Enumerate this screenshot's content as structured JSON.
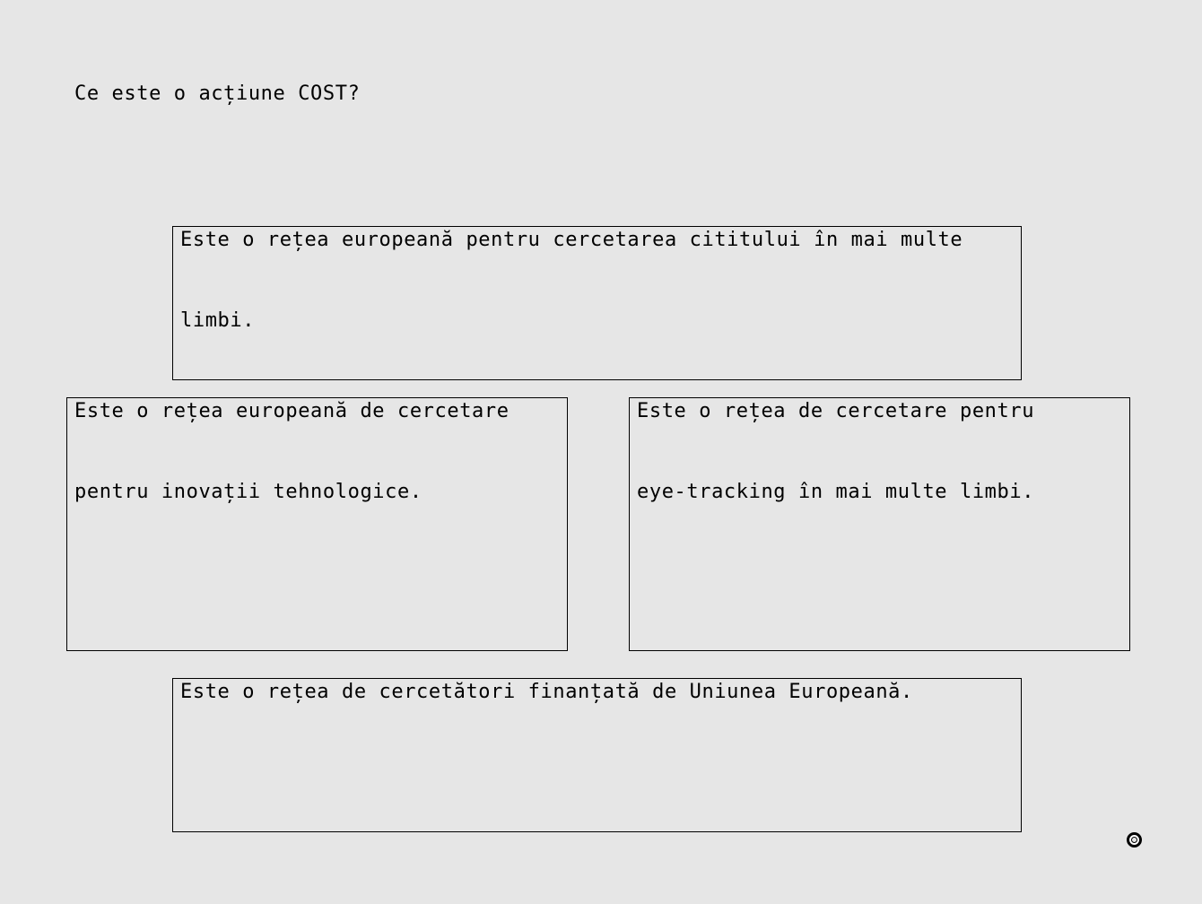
{
  "question": "Ce este o acțiune COST?",
  "options": [
    {
      "lines": [
        "Este o rețea europeană pentru cercetarea cititului în mai multe",
        "limbi."
      ]
    },
    {
      "lines": [
        "Este o rețea europeană de cercetare",
        "pentru inovații tehnologice."
      ]
    },
    {
      "lines": [
        "Este o rețea de cercetare pentru",
        "eye-tracking în mai multe limbi."
      ]
    },
    {
      "lines": [
        "Este o rețea de cercetători finanțată de Uniunea Europeană."
      ]
    }
  ],
  "icons": {
    "next": "circle-button-icon"
  }
}
